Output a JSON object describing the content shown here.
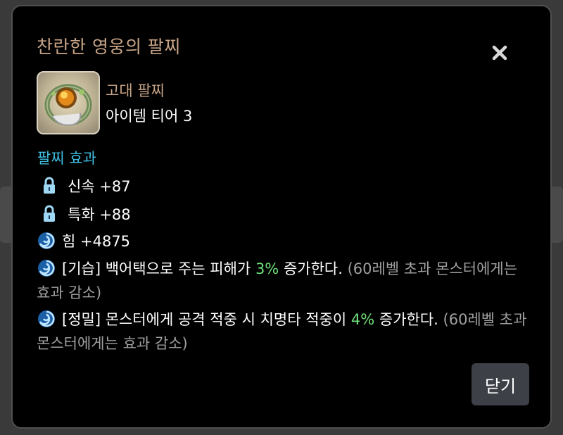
{
  "dialog": {
    "title": "찬란한 영웅의 팔찌",
    "close_button_label": "닫기"
  },
  "item": {
    "grade": "고대 팔찌",
    "tier": "아이템 티어 3",
    "icon": "bracelet-icon"
  },
  "effects": {
    "section_label": "팔찌 효과",
    "stats": [
      {
        "icon": "lock-icon",
        "text": "신속 +87"
      },
      {
        "icon": "lock-icon",
        "text": "특화 +88"
      },
      {
        "icon": "swirl-icon",
        "text": "힘 +4875"
      }
    ],
    "special": [
      {
        "icon": "swirl-icon",
        "prefix": "[기습] 백어택으로 주는 피해가 ",
        "highlight": "3%",
        "suffix": " 증가한다.",
        "note": " (60레벨 초과 몬스터에게는 효과 감소)"
      },
      {
        "icon": "swirl-icon",
        "prefix": "[정밀] 몬스터에게 공격 적중 시 치명타 적중이 ",
        "highlight": "4%",
        "suffix": " 증가한다.",
        "note": " (60레벨 초과 몬스터에게는 효과 감소)"
      }
    ]
  },
  "colors": {
    "title": "#c8a487",
    "section": "#3fbde0",
    "highlight": "#6fe07a",
    "note": "#a0a0a0",
    "button_bg": "#3d4047"
  }
}
